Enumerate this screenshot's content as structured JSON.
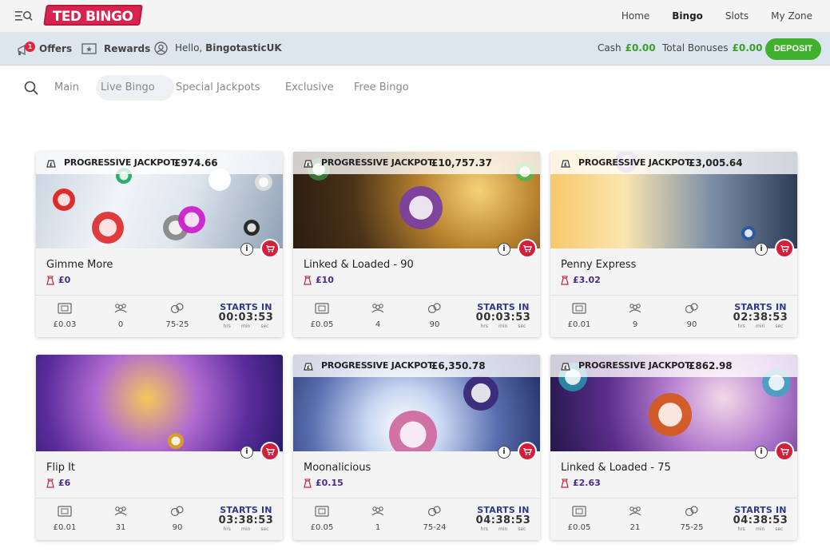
{
  "brand": {
    "logo_text": "TED BINGO",
    "accent": "#d8234f"
  },
  "topnav": {
    "links": [
      {
        "label": "Home",
        "active": false
      },
      {
        "label": "Bingo",
        "active": true
      },
      {
        "label": "Slots",
        "active": false
      },
      {
        "label": "My Zone",
        "active": false
      }
    ]
  },
  "account": {
    "offers_label": "Offers",
    "offers_count": "1",
    "rewards_label": "Rewards",
    "hello_prefix": "Hello, ",
    "username": "BingotasticUK",
    "cash_label": "Cash",
    "cash_value": "£0.00",
    "bonus_label": "Total Bonuses",
    "bonus_value": "£0.00",
    "deposit_label": "DEPOSIT"
  },
  "tabs": [
    "Main",
    "Live Bingo",
    "Special Jackpots",
    "Exclusive",
    "Free Bingo"
  ],
  "active_tab": "Live Bingo",
  "starts_label": "STARTS IN",
  "time_units": [
    "hrs",
    "min",
    "sec"
  ],
  "jackpot_label": "PROGRESSIVE JACKPOT",
  "cards": [
    {
      "name": "Gimme More",
      "jackpot": "£974.66",
      "prize": "£0",
      "ticket": "£0.03",
      "players": "0",
      "type": "75-25",
      "time": "00:03:53",
      "theme": "balls-light"
    },
    {
      "name": "Linked & Loaded - 90",
      "jackpot": "£10,757.37",
      "prize": "£10",
      "ticket": "£0.05",
      "players": "4",
      "type": "90",
      "time": "00:03:53",
      "theme": "vault-gold"
    },
    {
      "name": "Penny Express",
      "jackpot": "£3,005.64",
      "prize": "£3.02",
      "ticket": "£0.01",
      "players": "9",
      "type": "90",
      "time": "02:38:53",
      "theme": "train"
    },
    {
      "name": "Flip It",
      "jackpot": "",
      "prize": "£6",
      "ticket": "£0.01",
      "players": "31",
      "type": "90",
      "time": "03:38:53",
      "theme": "bell"
    },
    {
      "name": "Moonalicious",
      "jackpot": "£6,350.78",
      "prize": "£0.15",
      "ticket": "£0.05",
      "players": "1",
      "type": "75-24",
      "time": "04:38:53",
      "theme": "moon"
    },
    {
      "name": "Linked & Loaded - 75",
      "jackpot": "£862.98",
      "prize": "£2.63",
      "ticket": "£0.05",
      "players": "21",
      "type": "75-25",
      "time": "04:38:53",
      "theme": "vault-purple"
    }
  ]
}
